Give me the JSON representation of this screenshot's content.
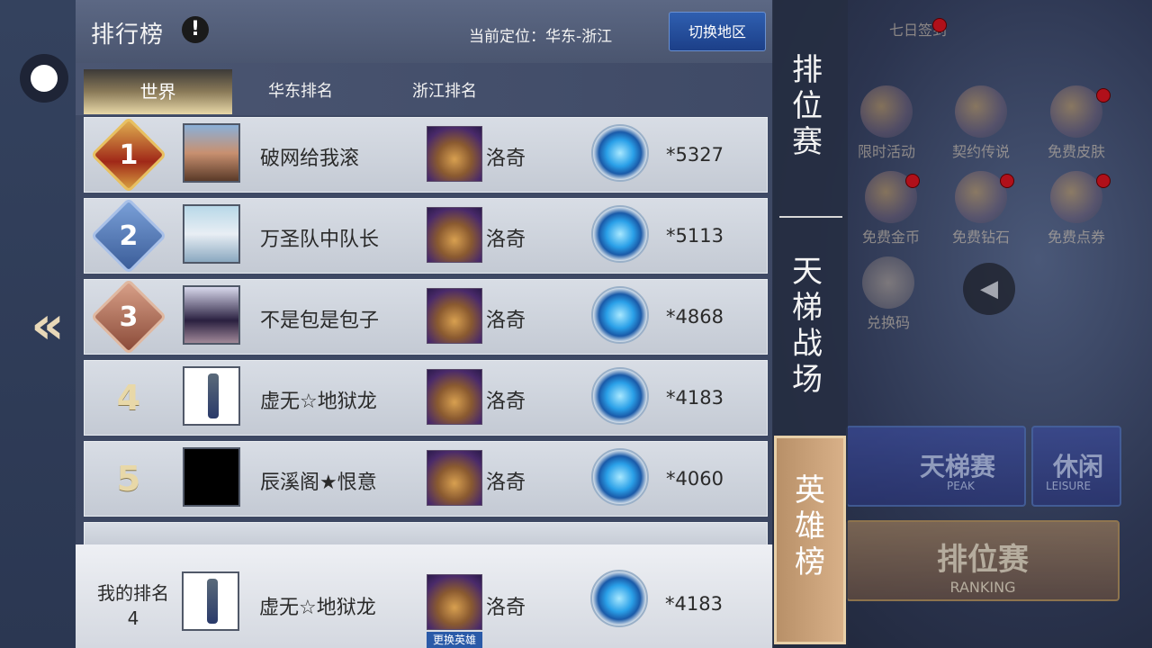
{
  "header": {
    "title": "排行榜",
    "info_icon": "!",
    "location": "当前定位：华东-浙江",
    "switch_button": "切换地区"
  },
  "tabs": [
    "世界",
    "华东排名",
    "浙江排名"
  ],
  "rows": [
    {
      "rank": "1",
      "name": "破网给我滚",
      "hero": "洛奇",
      "score": "*5327"
    },
    {
      "rank": "2",
      "name": "万圣队中队长",
      "hero": "洛奇",
      "score": "*5113"
    },
    {
      "rank": "3",
      "name": "不是包是包子",
      "hero": "洛奇",
      "score": "*4868"
    },
    {
      "rank": "4",
      "name": "虚无☆地狱龙",
      "hero": "洛奇",
      "score": "*4183"
    },
    {
      "rank": "5",
      "name": "辰溪阁★恨意",
      "hero": "洛奇",
      "score": "*4060"
    }
  ],
  "my_rank": {
    "label": "我的排名",
    "rank": "4",
    "name": "虚无☆地狱龙",
    "hero": "洛奇",
    "score": "*4183",
    "change_hero": "更换英雄"
  },
  "side_menu": {
    "tab1": "排\n位\n赛",
    "tab2": "天\n梯\n战\n场",
    "tab3": "英\n雄\n榜"
  },
  "lobby": {
    "items": [
      "七日签到",
      "限时活动",
      "契约传说",
      "免费皮肤",
      "免费金币",
      "免费钻石",
      "免费点券",
      "兑换码"
    ],
    "peak_label": "天梯赛",
    "peak_sub": "PEAK",
    "leisure_label": "休闲",
    "leisure_sub": "LEISURE",
    "ranking_label": "排位赛",
    "ranking_sub": "RANKING"
  }
}
